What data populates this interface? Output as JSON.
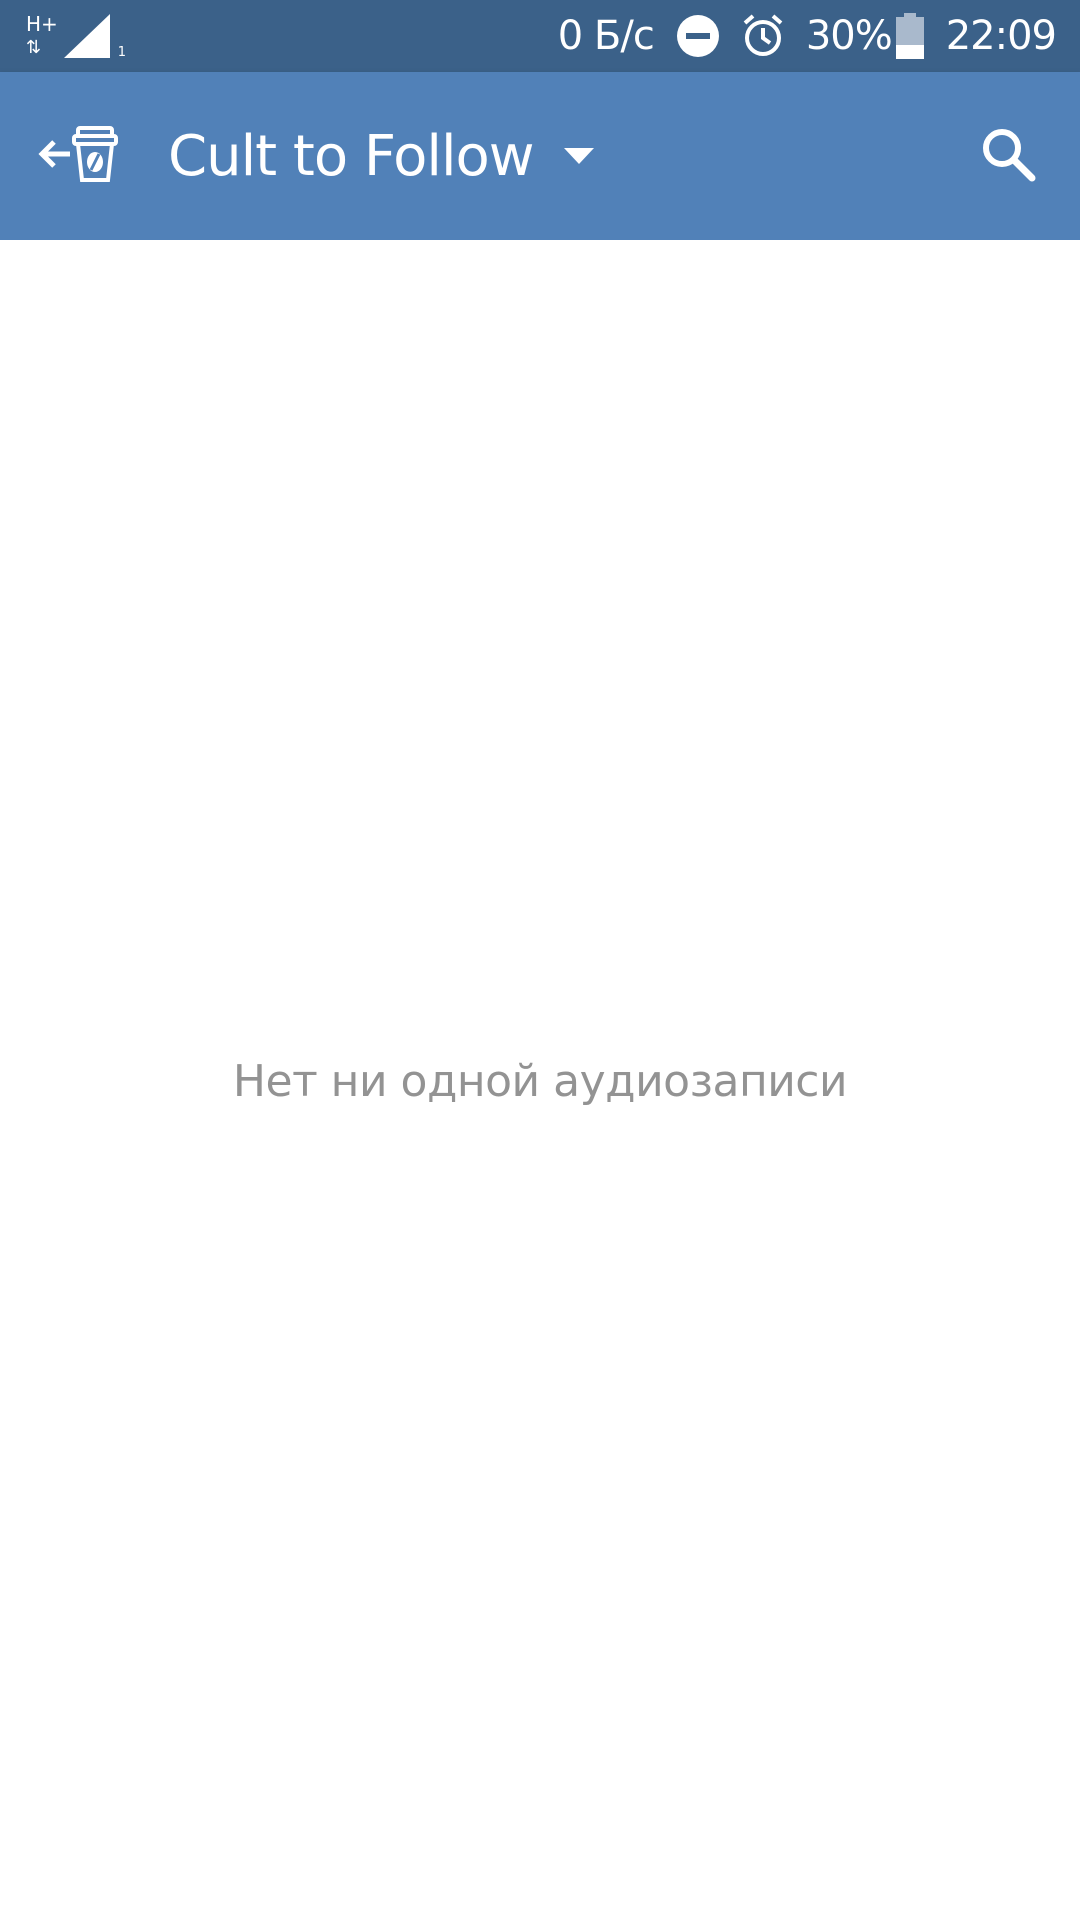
{
  "status_bar": {
    "network_type": "H+",
    "network_arrows": "⇅",
    "sim_slot": "1",
    "net_speed": "0 Б/с",
    "battery": "30%",
    "time": "22:09",
    "icons": [
      "network-type-icon",
      "signal-icon",
      "dnd-icon",
      "alarm-icon",
      "battery-icon"
    ]
  },
  "app_bar": {
    "title": "Cult to Follow",
    "icons": [
      "back-arrow-icon",
      "coffee-cup-logo-icon",
      "dropdown-triangle-icon",
      "search-icon"
    ]
  },
  "content": {
    "empty_message": "Нет ни одной аудиозаписи"
  },
  "colors": {
    "status_bar": "#3b6189",
    "app_bar": "#5181b8",
    "empty_text": "#939393",
    "background": "#ffffff"
  }
}
